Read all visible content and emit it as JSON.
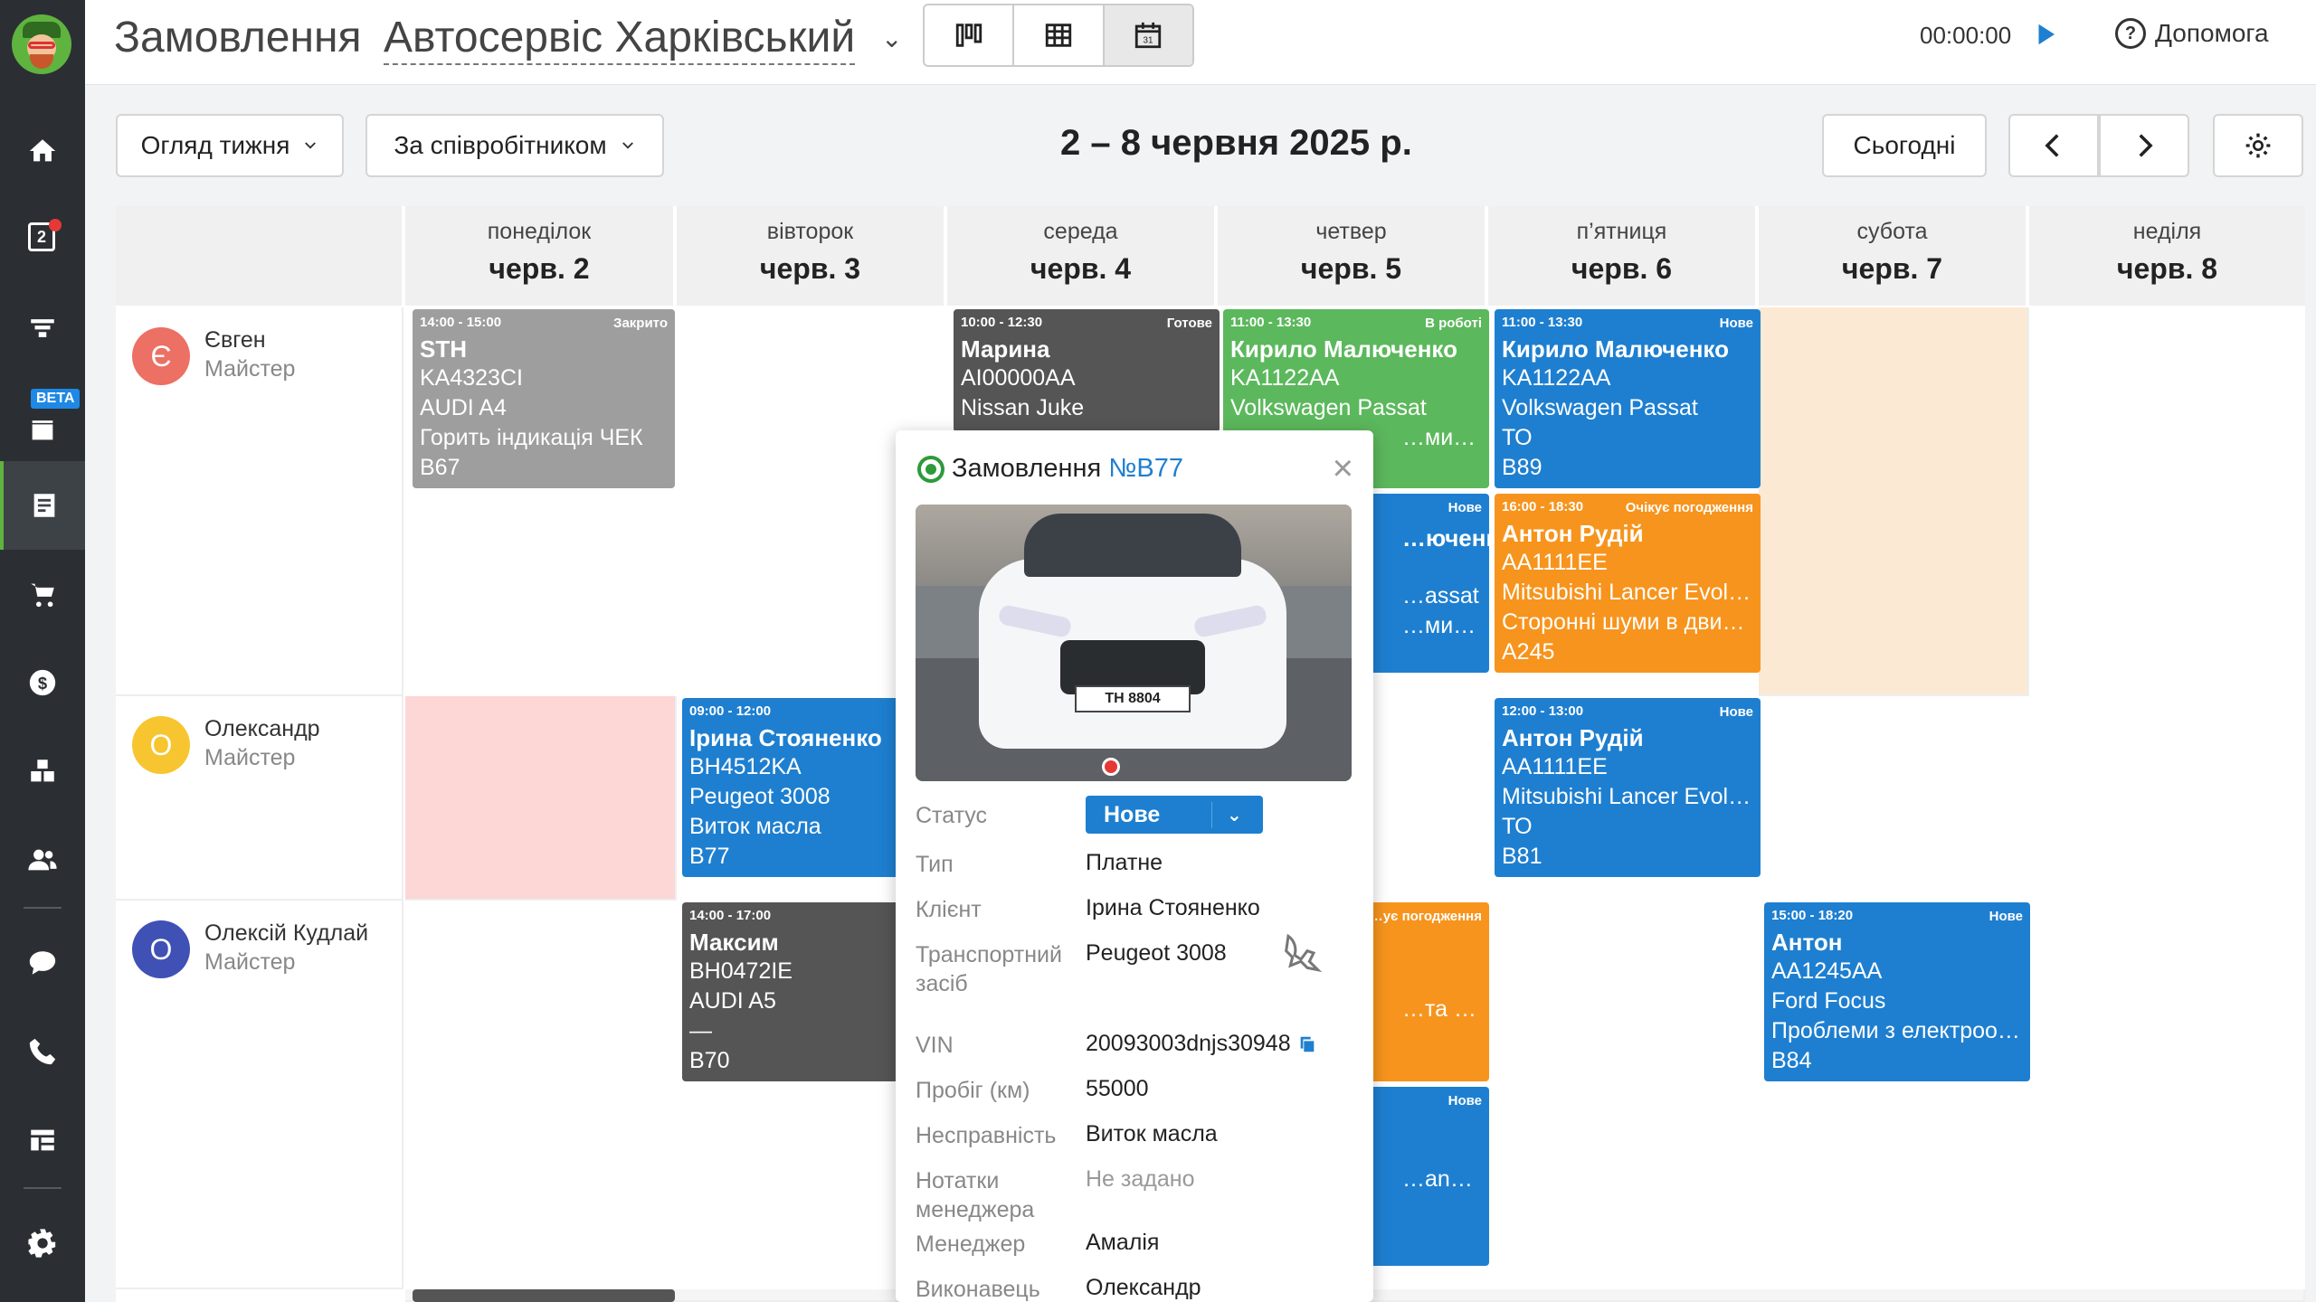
{
  "header": {
    "title": "Замовлення",
    "company": "Автосервіс Харківський",
    "timer": "00:00:00",
    "help": "Допомога"
  },
  "sidebar": {
    "notifications_count": "2",
    "beta_label": "BETA"
  },
  "toolbar": {
    "view_mode": "Огляд тижня",
    "group_by": "За співробітником",
    "range": "2 – 8 червня 2025 р.",
    "today": "Сьогодні"
  },
  "days": [
    {
      "dow": "понеділок",
      "date": "черв. 2"
    },
    {
      "dow": "вівторок",
      "date": "черв. 3"
    },
    {
      "dow": "середа",
      "date": "черв. 4"
    },
    {
      "dow": "четвер",
      "date": "черв. 5"
    },
    {
      "dow": "п’ятниця",
      "date": "черв. 6"
    },
    {
      "dow": "субота",
      "date": "черв. 7"
    },
    {
      "dow": "неділя",
      "date": "черв. 8"
    }
  ],
  "employees": [
    {
      "initial": "Є",
      "name": "Євген",
      "role": "Майстер",
      "color": "#ec7063"
    },
    {
      "initial": "О",
      "name": "Олександр",
      "role": "Майстер",
      "color": "#f7c52f"
    },
    {
      "initial": "О",
      "name": "Олексій Кудлай",
      "role": "Майстер",
      "color": "#3f51b5"
    }
  ],
  "cards": {
    "c1": {
      "time": "14:00 - 15:00",
      "status": "Закрито",
      "client": "STH",
      "lines": [
        "KA4323CI",
        "AUDI A4",
        "Горить індикація ЧЕК",
        "B67"
      ]
    },
    "c2": {
      "time": "10:00 - 12:30",
      "status": "Готове",
      "client": "Марина",
      "lines": [
        "AI00000AA",
        "Nissan Juke"
      ]
    },
    "c3": {
      "time": "11:00 - 13:30",
      "status": "В роботі",
      "client": "Кирило Малюченко",
      "lines": [
        "KA1122AA",
        "Volkswagen Passat",
        "…ми в двиг…"
      ]
    },
    "c4": {
      "time": "11:00 - 13:30",
      "status": "Нове",
      "client": "Кирило Малюченко",
      "lines": [
        "KA1122AA",
        "Volkswagen Passat",
        "ТО",
        "B89"
      ]
    },
    "c5": {
      "status": "Нове",
      "client": "…юченко",
      "lines": [
        "…assat",
        "…ми в двиг…"
      ]
    },
    "c6": {
      "time": "16:00 - 18:30",
      "status": "Очікує погодження",
      "client": "Антон Рудій",
      "lines": [
        "AA1111EE",
        "Mitsubishi Lancer Evol…",
        "Сторонні шуми в дви…",
        "A245"
      ]
    },
    "c7": {
      "time": "09:00 - 12:00",
      "client": "Ірина Стояненко",
      "lines": [
        "BH4512KA",
        "Peugeot 3008",
        "Виток масла",
        "B77"
      ]
    },
    "c8": {
      "time": "12:00 - 13:00",
      "status": "Нове",
      "client": "Антон Рудій",
      "lines": [
        "AA1111EE",
        "Mitsubishi Lancer Evol…",
        "ТО",
        "B81"
      ]
    },
    "c9": {
      "time": "14:00 - 17:00",
      "client": "Максим",
      "lines": [
        "BH0472IE",
        "AUDI A5",
        "—",
        "B70"
      ]
    },
    "c10": {
      "status": "…ує погодження",
      "lines": [
        "…та паль…"
      ]
    },
    "c11": {
      "status": "Нове",
      "lines": [
        "…and Picas…"
      ]
    },
    "c12": {
      "time": "15:00 - 18:20",
      "status": "Нове",
      "client": "Антон",
      "lines": [
        "AA1245AA",
        "Ford Focus",
        "Проблеми з електроо…",
        "B84"
      ]
    }
  },
  "popup": {
    "title": "Замовлення",
    "number": "№B77",
    "plate": "TH 8804",
    "status_label": "Статус",
    "status": "Нове",
    "rows": [
      {
        "k": "Тип",
        "v": "Платне"
      },
      {
        "k": "Клієнт",
        "v": "Ірина Стояненко"
      },
      {
        "k": "Транспортний засіб",
        "v": "Peugeot 3008"
      },
      {
        "k": "VIN",
        "v": "20093003dnjs30948"
      },
      {
        "k": "Пробіг (км)",
        "v": "55000"
      },
      {
        "k": "Несправність",
        "v": "Виток масла"
      },
      {
        "k": "Нотатки менеджера",
        "v": "Не задано"
      },
      {
        "k": "Менеджер",
        "v": "Амалія"
      },
      {
        "k": "Виконавець",
        "v": "Олександр"
      }
    ]
  },
  "colors": {
    "accent": "#5fb33f",
    "blue": "#1e7fd0",
    "orange": "#f7941d",
    "green": "#5cb85c",
    "gray": "#9e9e9e",
    "dark": "#555555"
  }
}
